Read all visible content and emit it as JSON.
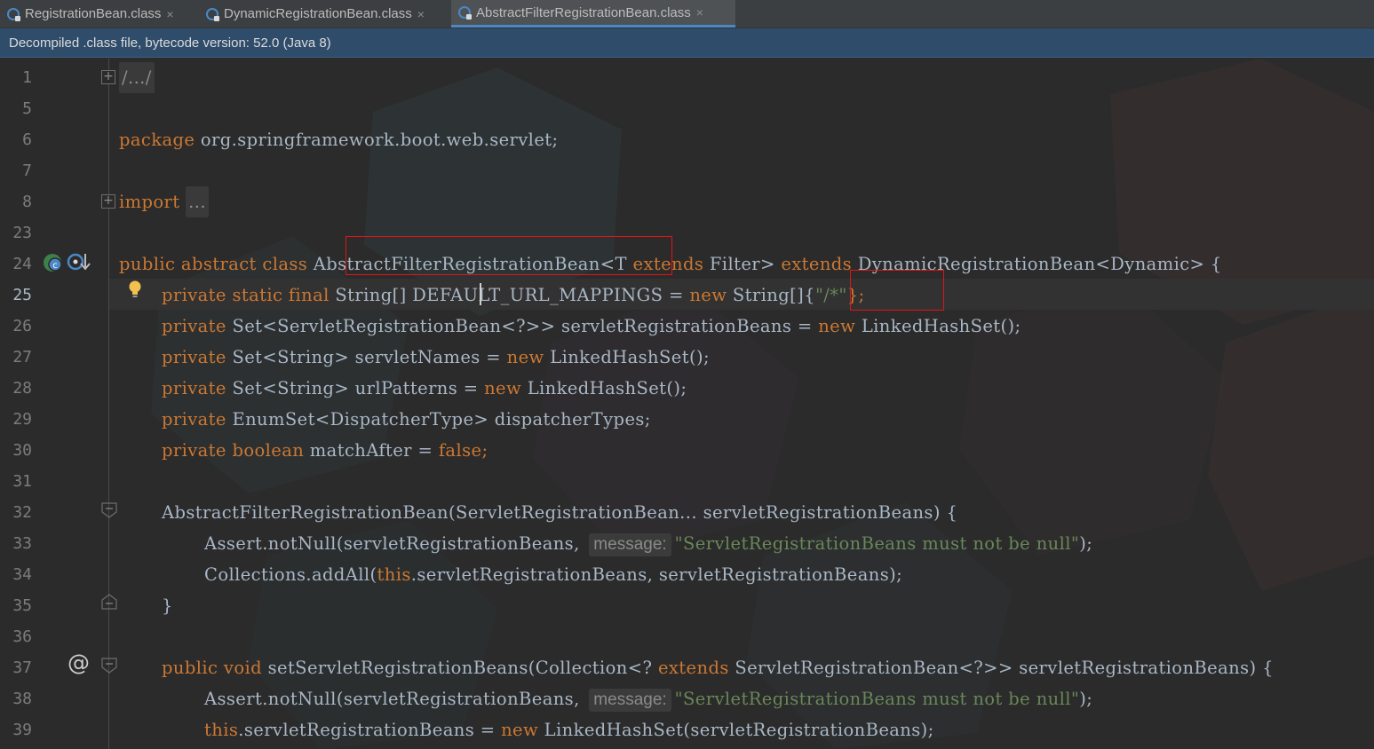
{
  "tabs": [
    {
      "label": "RegistrationBean.class",
      "close": "×",
      "active": false
    },
    {
      "label": "DynamicRegistrationBean.class",
      "close": "×",
      "active": false
    },
    {
      "label": "AbstractFilterRegistrationBean.class",
      "close": "×",
      "active": true
    }
  ],
  "banner": {
    "text": "Decompiled .class file, bytecode version: 52.0 (Java 8)"
  },
  "colors": {
    "background": "#2b2b2b",
    "keyword": "#cc7832",
    "string": "#6a8759",
    "text": "#a9b7c6",
    "line_number": "#7c7c7c",
    "highlight_box": "#e01515",
    "banner": "#2f4c6b"
  },
  "gutter_icons": {
    "line24": [
      "class-implementation-icon",
      "override-arrow-icon"
    ],
    "line25": "lightbulb-icon",
    "line37": "at-sign-icon",
    "at_symbol": "@"
  },
  "lines": [
    {
      "num": "1"
    },
    {
      "num": "5"
    },
    {
      "num": "6"
    },
    {
      "num": "7"
    },
    {
      "num": "8"
    },
    {
      "num": "23"
    },
    {
      "num": "24"
    },
    {
      "num": "25"
    },
    {
      "num": "26"
    },
    {
      "num": "27"
    },
    {
      "num": "28"
    },
    {
      "num": "29"
    },
    {
      "num": "30"
    },
    {
      "num": "31"
    },
    {
      "num": "32"
    },
    {
      "num": "33"
    },
    {
      "num": "34"
    },
    {
      "num": "35"
    },
    {
      "num": "36"
    },
    {
      "num": "37"
    },
    {
      "num": "38"
    },
    {
      "num": "39"
    }
  ],
  "code": {
    "l1_fold": "/.../",
    "l6_kw": "package",
    "l6_rest": " org.springframework.boot.web.servlet;",
    "l8_kw": "import",
    "l8_fold": "...",
    "l24_kw": "public abstract class",
    "l24_name": "AbstractFilterRegistrationBean",
    "l24_a": "<T ",
    "l24_kw2": "extends",
    "l24_b": " Filter> ",
    "l24_kw3": "extends",
    "l24_c": " DynamicRegistrationBean<Dynamic> {",
    "l25_kw": "private static final",
    "l25_a": " String[] ",
    "l25_b": "DEFAULT_URL_MAPPINGS = ",
    "l25_kw2": "new",
    "l25_c": " String[]{",
    "l25_str": "\"/*\"",
    "l25_d": "};",
    "l26_kw": "private",
    "l26_a": " Set<ServletRegistrationBean<?>> servletRegistrationBeans = ",
    "l26_kw2": "new",
    "l26_b": " LinkedHashSet();",
    "l27_kw": "private",
    "l27_a": " Set<String> servletNames = ",
    "l27_kw2": "new",
    "l27_b": " LinkedHashSet();",
    "l28_kw": "private",
    "l28_a": " Set<String> urlPatterns = ",
    "l28_kw2": "new",
    "l28_b": " LinkedHashSet();",
    "l29_kw": "private",
    "l29_a": " EnumSet<DispatcherType> dispatcherTypes;",
    "l30_kw": "private boolean",
    "l30_a": " matchAfter = ",
    "l30_kw2": "false",
    "l30_b": ";",
    "l32": "AbstractFilterRegistrationBean(ServletRegistrationBean... servletRegistrationBeans) {",
    "l33_a": "Assert.notNull(servletRegistrationBeans, ",
    "l33_hint": "message:",
    "l33_str": "\"ServletRegistrationBeans must not be null\"",
    "l33_b": ");",
    "l34_a": "Collections.addAll(",
    "l34_kw": "this",
    "l34_b": ".servletRegistrationBeans, servletRegistrationBeans);",
    "l35": "}",
    "l37_kw": "public void",
    "l37_a": " setServletRegistrationBeans(Collection<? ",
    "l37_kw2": "extends",
    "l37_b": " ServletRegistrationBean<?>> servletRegistrationBeans) {",
    "l38_a": "Assert.notNull(servletRegistrationBeans, ",
    "l38_hint": "message:",
    "l38_str": "\"ServletRegistrationBeans must not be null\"",
    "l38_b": ");",
    "l39_kw": "this",
    "l39_a": ".servletRegistrationBeans = ",
    "l39_kw2": "new",
    "l39_b": " LinkedHashSet(servletRegistrationBeans);"
  }
}
